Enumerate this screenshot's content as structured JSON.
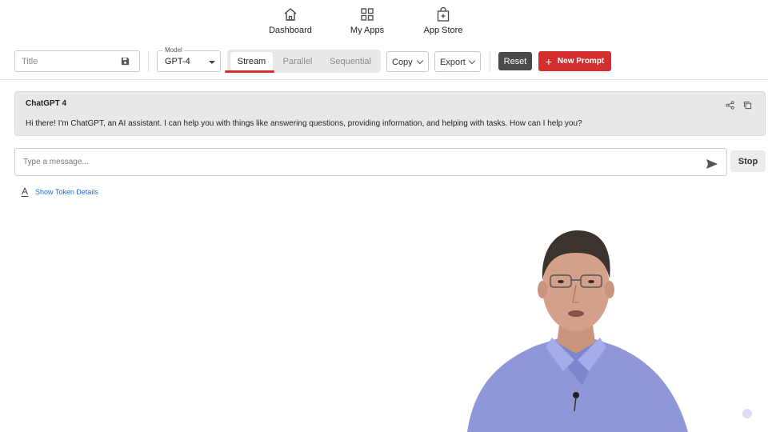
{
  "nav": {
    "dashboard": "Dashboard",
    "my_apps": "My Apps",
    "app_store": "App Store"
  },
  "toolbar": {
    "title_placeholder": "Title",
    "model_legend": "Model",
    "model_value": "GPT-4",
    "modes": [
      "Stream",
      "Parallel",
      "Sequential"
    ],
    "active_mode": "Stream",
    "copy_label": "Copy",
    "export_label": "Export",
    "reset_label": "Reset",
    "new_prompt_label": "New Prompt"
  },
  "chat": {
    "sender": "ChatGPT 4",
    "message": "Hi there! I'm ChatGPT, an AI assistant. I can help you with things like answering questions, providing information, and helping with tasks. How can I help you?"
  },
  "composer": {
    "placeholder": "Type a message...",
    "stop_label": "Stop"
  },
  "token_link": "Show Token Details",
  "colors": {
    "accent_red": "#d32f2f",
    "reset_dark": "#4a4a4a",
    "link_blue": "#1a6fd6",
    "card_bg": "#e8e8e8"
  },
  "icons": [
    "home-icon",
    "grid-icon",
    "shopping-bag-plus-icon",
    "save-icon",
    "share-icon",
    "copy-icon",
    "send-icon",
    "font-icon"
  ],
  "presenter_video": "presenter"
}
